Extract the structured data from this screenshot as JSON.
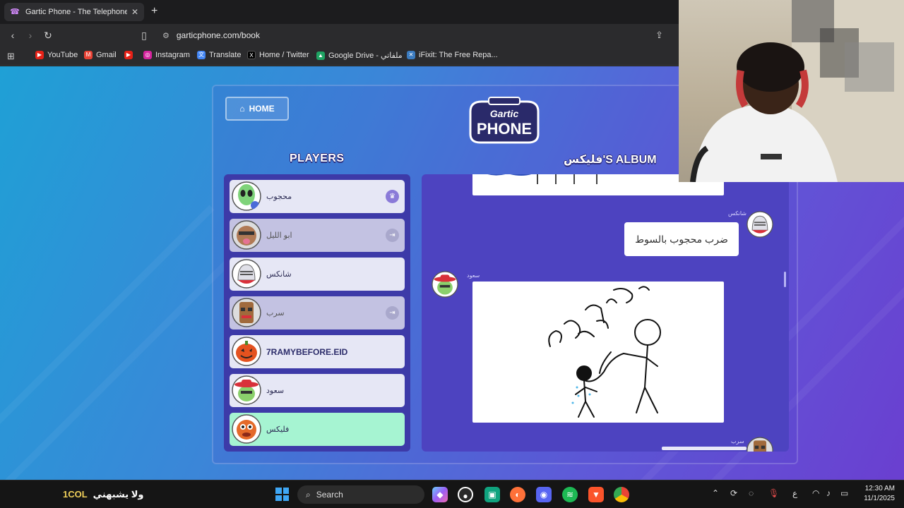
{
  "browser": {
    "tab_title": "Gartic Phone - The Telephone Ga",
    "url": "garticphone.com/book",
    "bookmarks": [
      "YouTube",
      "Gmail",
      "Instagram",
      "Translate",
      "Home / Twitter",
      "Google Drive - ملفاتي",
      "iFixit: The Free Repa..."
    ]
  },
  "game": {
    "home_label": "HOME",
    "logo_line1": "Gartic",
    "logo_line2": "PHONE",
    "players_title": "PLAYERS",
    "album_title": "فليكس'S ALBUM",
    "players": [
      {
        "name": "محجوب",
        "state": "host"
      },
      {
        "name": "ابو الليل",
        "state": "away"
      },
      {
        "name": "شانكس",
        "state": "normal"
      },
      {
        "name": "سرب",
        "state": "away"
      },
      {
        "name": "7RAMYBEFORE.EID",
        "state": "normal"
      },
      {
        "name": "سعود",
        "state": "normal"
      },
      {
        "name": "فليكس",
        "state": "active"
      }
    ],
    "album": {
      "msg_author": "شانكس",
      "msg_text": "ضرب محجوب بالسوط",
      "drawing_author": "سعود",
      "next_author": "سرب"
    }
  },
  "taskbar": {
    "left_text_1": "1COL",
    "left_text_2": "ولا يشبهني",
    "search_label": "Search",
    "clock_time": "12:30 AM",
    "clock_date": "11/1/2025",
    "lang": "ع"
  },
  "colors": {
    "accent": "#5f5ad8",
    "player_active": "#a6f4d2"
  }
}
